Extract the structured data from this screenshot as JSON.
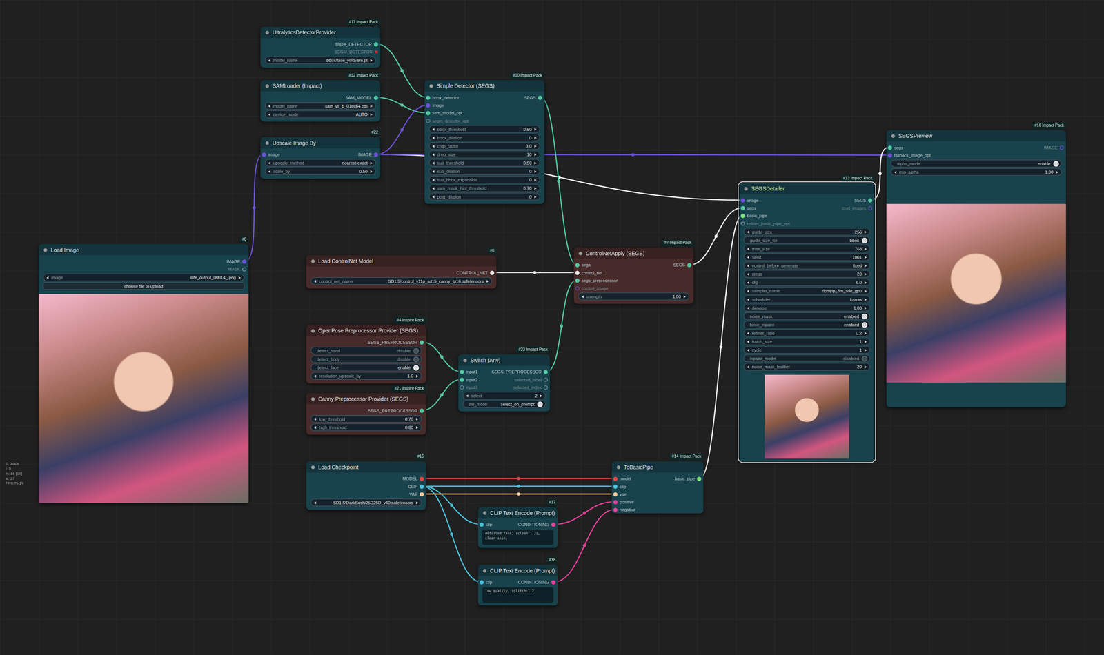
{
  "stats": [
    "T: 0.00s",
    "I: 0",
    "N: 16 [16]",
    "V: 37",
    "FPS:75.19"
  ],
  "nodes": [
    {
      "title": "UltralyticsDetectorProvider",
      "badge": "#11 Impact Pack",
      "color": "#18424c",
      "selected": false,
      "preview": false,
      "inputs": [],
      "outputs": [
        {
          "label": "BBOX_DETECTOR",
          "color": "#52c8a0",
          "connected": true
        },
        {
          "label": "SEGM_DETECTOR",
          "color": "#e03030",
          "connected": false,
          "marker": "✖"
        }
      ],
      "widgets": [
        {
          "kind": "value",
          "label": "model_name",
          "value": "bbox/face_yolov8m.pt"
        }
      ]
    },
    {
      "title": "SAMLoader (Impact)",
      "badge": "#12 Impact Pack",
      "color": "#18424c",
      "selected": false,
      "preview": false,
      "inputs": [],
      "outputs": [
        {
          "label": "SAM_MODEL",
          "color": "#52c8a0",
          "connected": true
        }
      ],
      "widgets": [
        {
          "kind": "value",
          "label": "model_name",
          "value": "sam_vit_b_01ec64.pth"
        },
        {
          "kind": "value",
          "label": "device_mode",
          "value": "AUTO"
        }
      ]
    },
    {
      "title": "Upscale Image By",
      "badge": "#22",
      "color": "#18424c",
      "selected": false,
      "preview": false,
      "inputs": [
        {
          "label": "image",
          "color": "#6e52d8",
          "connected": true
        }
      ],
      "outputs": [
        {
          "label": "IMAGE",
          "color": "#6e52d8",
          "connected": true
        }
      ],
      "widgets": [
        {
          "kind": "value",
          "label": "upscale_method",
          "value": "nearest-exact"
        },
        {
          "kind": "value",
          "label": "scale_by",
          "value": "0.50"
        }
      ]
    },
    {
      "title": "Load Image",
      "badge": "#8",
      "color": "#18424c",
      "selected": false,
      "preview": true,
      "inputs": [],
      "outputs": [
        {
          "label": "IMAGE",
          "color": "#6e52d8",
          "connected": true
        },
        {
          "label": "MASK",
          "color": "#9fb3bd",
          "connected": false
        }
      ],
      "widgets": [
        {
          "kind": "value",
          "label": "image",
          "value": "illite_output_00014_.png"
        },
        {
          "kind": "button",
          "value": "choose file to upload"
        }
      ]
    },
    {
      "title": "Simple Detector (SEGS)",
      "badge": "#10 Impact Pack",
      "color": "#18424c",
      "selected": false,
      "preview": false,
      "inputs": [
        {
          "label": "bbox_detector",
          "color": "#52c8a0",
          "connected": true
        },
        {
          "label": "image",
          "color": "#6e52d8",
          "connected": true
        },
        {
          "label": "sam_model_opt",
          "color": "#52c8a0",
          "connected": true
        },
        {
          "label": "segm_detector_opt",
          "color": "#8aa0a8",
          "connected": false
        }
      ],
      "outputs": [
        {
          "label": "SEGS",
          "color": "#52c8a0",
          "connected": true
        }
      ],
      "widgets": [
        {
          "kind": "value",
          "label": "bbox_threshold",
          "value": "0.50"
        },
        {
          "kind": "value",
          "label": "bbox_dilation",
          "value": "0"
        },
        {
          "kind": "value",
          "label": "crop_factor",
          "value": "3.0"
        },
        {
          "kind": "value",
          "label": "drop_size",
          "value": "10"
        },
        {
          "kind": "value",
          "label": "sub_threshold",
          "value": "0.50"
        },
        {
          "kind": "value",
          "label": "sub_dilation",
          "value": "0"
        },
        {
          "kind": "value",
          "label": "sub_bbox_expansion",
          "value": "0"
        },
        {
          "kind": "value",
          "label": "sam_mask_hint_threshold",
          "value": "0.70"
        },
        {
          "kind": "value",
          "label": "post_dilation",
          "value": "0"
        }
      ]
    },
    {
      "title": "Load ControlNet Model",
      "badge": "#6",
      "color": "#472a2a",
      "selected": false,
      "preview": false,
      "inputs": [],
      "outputs": [
        {
          "label": "CONTROL_NET",
          "color": "#e8e8e8",
          "connected": true
        }
      ],
      "widgets": [
        {
          "kind": "value",
          "label": "control_net_name",
          "value": "SD1.5/control_v11p_sd15_canny_fp16.safetensors"
        }
      ]
    },
    {
      "title": "ControlNetApply (SEGS)",
      "badge": "#7 Impact Pack",
      "color": "#472a2a",
      "selected": false,
      "preview": false,
      "inputs": [
        {
          "label": "segs",
          "color": "#52c8a0",
          "connected": true
        },
        {
          "label": "control_net",
          "color": "#e8e8e8",
          "connected": true
        },
        {
          "label": "segs_preprocessor",
          "color": "#52c8a0",
          "connected": true
        },
        {
          "label": "control_image",
          "color": "#6e52d8",
          "connected": false
        }
      ],
      "outputs": [
        {
          "label": "SEGS",
          "color": "#52c8a0",
          "connected": true
        }
      ],
      "widgets": [
        {
          "kind": "value",
          "label": "strength",
          "value": "1.00"
        }
      ]
    },
    {
      "title": "OpenPose Preprocessor Provider (SEGS)",
      "badge": "#4 Inspire Pack",
      "color": "#472a2a",
      "selected": false,
      "preview": false,
      "inputs": [],
      "outputs": [
        {
          "label": "SEGS_PREPROCESSOR",
          "color": "#52c8a0",
          "connected": true
        }
      ],
      "widgets": [
        {
          "kind": "toggle",
          "label": "detect_hand",
          "value": "disable",
          "on": false
        },
        {
          "kind": "toggle",
          "label": "detect_body",
          "value": "disable",
          "on": false
        },
        {
          "kind": "toggle",
          "label": "detect_face",
          "value": "enable",
          "on": true
        },
        {
          "kind": "value",
          "label": "resolution_upscale_by",
          "value": "1.0"
        }
      ]
    },
    {
      "title": "Canny Preprocessor Provider (SEGS)",
      "badge": "#21 Inspire Pack",
      "color": "#472a2a",
      "selected": false,
      "preview": false,
      "inputs": [],
      "outputs": [
        {
          "label": "SEGS_PREPROCESSOR",
          "color": "#52c8a0",
          "connected": true
        }
      ],
      "widgets": [
        {
          "kind": "value",
          "label": "low_threshold",
          "value": "0.70"
        },
        {
          "kind": "value",
          "label": "high_threshold",
          "value": "0.80"
        }
      ]
    },
    {
      "title": "Switch (Any)",
      "badge": "#23 Impact Pack",
      "color": "#18424c",
      "selected": false,
      "preview": false,
      "inputs": [
        {
          "label": "input1",
          "color": "#52c8a0",
          "connected": true
        },
        {
          "label": "input2",
          "color": "#52c8a0",
          "connected": true
        },
        {
          "label": "input3",
          "color": "#8aa0a8",
          "connected": false
        }
      ],
      "outputs": [
        {
          "label": "SEGS_PREPROCESSOR",
          "color": "#52c8a0",
          "connected": true
        },
        {
          "label": "selected_label",
          "color": "#8aa0a8",
          "connected": false
        },
        {
          "label": "selected_index",
          "color": "#8aa0a8",
          "connected": false
        }
      ],
      "widgets": [
        {
          "kind": "value",
          "label": "select",
          "value": "2"
        },
        {
          "kind": "toggle",
          "label": "sel_mode",
          "value": "select_on_prompt",
          "on": true
        }
      ]
    },
    {
      "title": "Load Checkpoint",
      "badge": "#15",
      "color": "#18424c",
      "selected": false,
      "preview": false,
      "inputs": [],
      "outputs": [
        {
          "label": "MODEL",
          "color": "#e04848",
          "connected": true
        },
        {
          "label": "CLIP",
          "color": "#48c0d8",
          "connected": true
        },
        {
          "label": "VAE",
          "color": "#f5c896",
          "connected": true
        }
      ],
      "widgets": [
        {
          "kind": "value",
          "value": "SD1.5\\DarkSushi25D25D_v40.safetensors"
        }
      ]
    },
    {
      "title": "CLIP Text Encode (Prompt)",
      "badge": "#17",
      "color": "#18424c",
      "selected": false,
      "preview": false,
      "inputs": [
        {
          "label": "clip",
          "color": "#48c0d8",
          "connected": true
        }
      ],
      "outputs": [
        {
          "label": "CONDITIONING",
          "color": "#e8409a",
          "connected": true
        }
      ],
      "widgets": [
        {
          "kind": "text",
          "value": "detailed face, (clean:1.2), clear skin,"
        }
      ]
    },
    {
      "title": "CLIP Text Encode (Prompt)",
      "badge": "#18",
      "color": "#18424c",
      "selected": false,
      "preview": false,
      "inputs": [
        {
          "label": "clip",
          "color": "#48c0d8",
          "connected": true
        }
      ],
      "outputs": [
        {
          "label": "CONDITIONING",
          "color": "#e8409a",
          "connected": true
        }
      ],
      "widgets": [
        {
          "kind": "text",
          "value": "low quality, (glitch:1.2)"
        }
      ]
    },
    {
      "title": "ToBasicPipe",
      "badge": "#14 Impact Pack",
      "color": "#18424c",
      "selected": false,
      "preview": false,
      "inputs": [
        {
          "label": "model",
          "color": "#e04848",
          "connected": true
        },
        {
          "label": "clip",
          "color": "#48c0d8",
          "connected": true
        },
        {
          "label": "vae",
          "color": "#f5c896",
          "connected": true
        },
        {
          "label": "positive",
          "color": "#e8409a",
          "connected": true
        },
        {
          "label": "negative",
          "color": "#e8409a",
          "connected": true
        }
      ],
      "outputs": [
        {
          "label": "basic_pipe",
          "color": "#7ce27c",
          "connected": true
        }
      ],
      "widgets": []
    },
    {
      "title": "SEGSDetailer",
      "badge": "#13 Impact Pack",
      "color": "#18424c",
      "selected": true,
      "preview": true,
      "inputs": [
        {
          "label": "image",
          "color": "#6e52d8",
          "connected": true
        },
        {
          "label": "segs",
          "color": "#52c8a0",
          "connected": true
        },
        {
          "label": "basic_pipe",
          "color": "#7ce27c",
          "connected": true
        },
        {
          "label": "refiner_basic_pipe_opt",
          "color": "#8aa0a8",
          "connected": false
        }
      ],
      "outputs": [
        {
          "label": "SEGS",
          "color": "#52c8a0",
          "connected": true
        },
        {
          "label": "cnet_images",
          "color": "#6e52d8",
          "connected": false
        }
      ],
      "widgets": [
        {
          "kind": "value",
          "label": "guide_size",
          "value": "256"
        },
        {
          "kind": "toggle",
          "label": "guide_size_for",
          "value": "bbox",
          "on": true
        },
        {
          "kind": "value",
          "label": "max_size",
          "value": "768"
        },
        {
          "kind": "value",
          "label": "seed",
          "value": "1001"
        },
        {
          "kind": "value",
          "label": "control_before_generate",
          "value": "fixed"
        },
        {
          "kind": "value",
          "label": "steps",
          "value": "20"
        },
        {
          "kind": "value",
          "label": "cfg",
          "value": "6.0"
        },
        {
          "kind": "value",
          "label": "sampler_name",
          "value": "dpmpp_3m_sde_gpu"
        },
        {
          "kind": "value",
          "label": "scheduler",
          "value": "karras"
        },
        {
          "kind": "value",
          "label": "denoise",
          "value": "1.00"
        },
        {
          "kind": "toggle",
          "label": "noise_mask",
          "value": "enabled",
          "on": true
        },
        {
          "kind": "toggle",
          "label": "force_inpaint",
          "value": "enabled",
          "on": true
        },
        {
          "kind": "value",
          "label": "refiner_ratio",
          "value": "0.2"
        },
        {
          "kind": "value",
          "label": "batch_size",
          "value": "1"
        },
        {
          "kind": "value",
          "label": "cycle",
          "value": "1"
        },
        {
          "kind": "toggle",
          "label": "inpaint_model",
          "value": "disabled",
          "on": false
        },
        {
          "kind": "value",
          "label": "noise_mask_feather",
          "value": "20"
        }
      ]
    },
    {
      "title": "SEGSPreview",
      "badge": "#16 Impact Pack",
      "color": "#18424c",
      "selected": false,
      "preview": true,
      "inputs": [
        {
          "label": "segs",
          "color": "#52c8a0",
          "connected": true
        },
        {
          "label": "fallback_image_opt",
          "color": "#6e52d8",
          "connected": true
        }
      ],
      "outputs": [
        {
          "label": "IMAGE",
          "color": "#6e52d8",
          "connected": false
        }
      ],
      "widgets": [
        {
          "kind": "toggle",
          "label": "alpha_mode",
          "value": "enable",
          "on": true
        },
        {
          "kind": "value",
          "label": "min_alpha",
          "value": "1.00"
        }
      ]
    }
  ]
}
